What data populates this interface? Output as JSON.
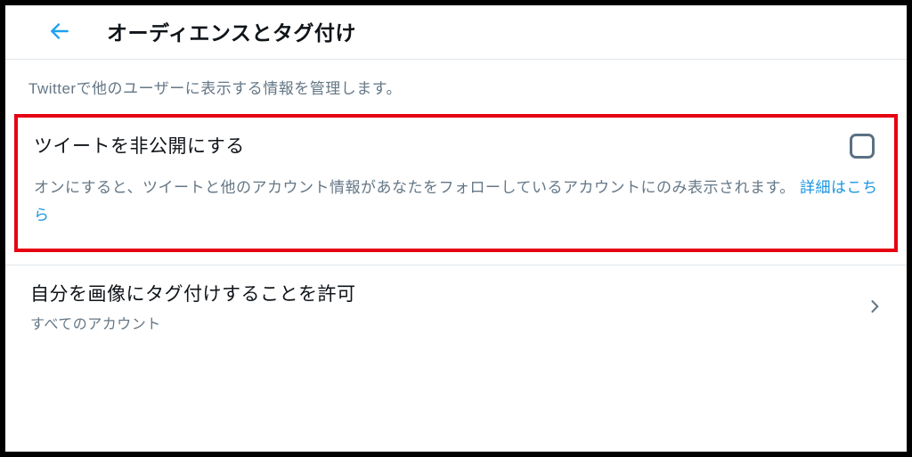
{
  "header": {
    "title": "オーディエンスとタグ付け"
  },
  "description": "Twitterで他のユーザーに表示する情報を管理します。",
  "protect_tweets": {
    "title": "ツイートを非公開にする",
    "description": "オンにすると、ツイートと他のアカウント情報があなたをフォローしているアカウントにのみ表示されます。 ",
    "link": "詳細はこちら"
  },
  "photo_tagging": {
    "title": "自分を画像にタグ付けすることを許可",
    "subtitle": "すべてのアカウント"
  }
}
